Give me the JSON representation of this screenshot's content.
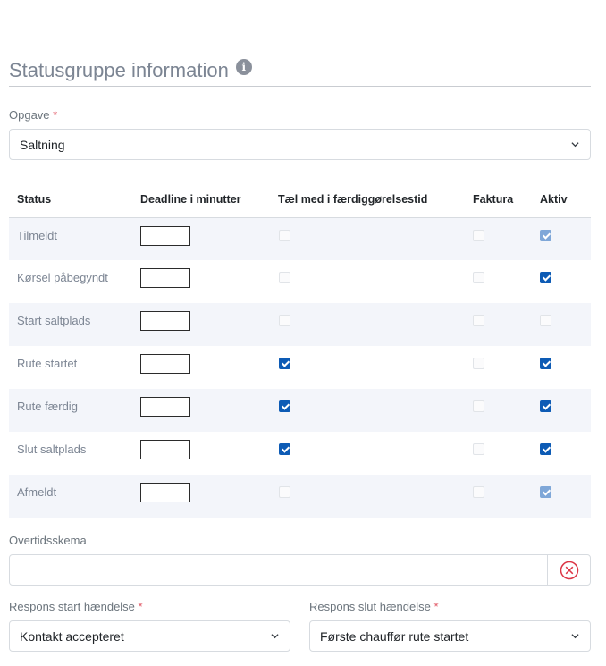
{
  "section": {
    "title": "Statusgruppe information",
    "info_icon": "info-icon"
  },
  "opgave": {
    "label": "Opgave",
    "required_mark": "*",
    "value": "Saltning"
  },
  "table": {
    "headers": [
      "Status",
      "Deadline i minutter",
      "Tæl med i færdiggørelsestid",
      "Faktura",
      "Aktiv"
    ],
    "rows": [
      {
        "status": "Tilmeldt",
        "deadline": "",
        "taeller": "disabled",
        "faktura": "disabled",
        "aktiv": "checked-disabled"
      },
      {
        "status": "Kørsel påbegyndt",
        "deadline": "",
        "taeller": "disabled",
        "faktura": "disabled",
        "aktiv": "checked"
      },
      {
        "status": "Start saltplads",
        "deadline": "",
        "taeller": "disabled",
        "faktura": "disabled",
        "aktiv": "disabled"
      },
      {
        "status": "Rute startet",
        "deadline": "",
        "taeller": "checked",
        "faktura": "disabled",
        "aktiv": "checked"
      },
      {
        "status": "Rute færdig",
        "deadline": "",
        "taeller": "checked",
        "faktura": "disabled",
        "aktiv": "checked"
      },
      {
        "status": "Slut saltplads",
        "deadline": "",
        "taeller": "checked",
        "faktura": "disabled",
        "aktiv": "checked"
      },
      {
        "status": "Afmeldt",
        "deadline": "",
        "taeller": "disabled",
        "faktura": "disabled",
        "aktiv": "checked-disabled"
      }
    ]
  },
  "overtid": {
    "label": "Overtidsskema",
    "value": "",
    "clear_icon": "close-circle-icon"
  },
  "respons_start": {
    "label": "Respons start hændelse",
    "required_mark": "*",
    "value": "Kontakt accepteret"
  },
  "respons_slut": {
    "label": "Respons slut hændelse",
    "required_mark": "*",
    "value": "Første chauffør rute startet"
  },
  "colors": {
    "accent": "#0d5bb5",
    "required": "#e05260",
    "title": "#7c8593",
    "row_stripe": "#f3f5fa",
    "clear_icon": "#dc3545"
  }
}
